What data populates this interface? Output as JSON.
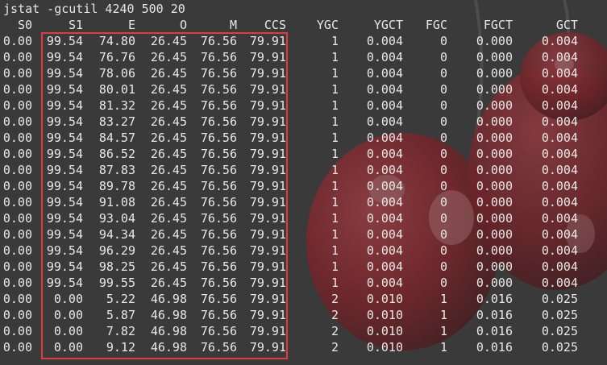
{
  "command": "jstat -gcutil 4240 500 20",
  "colors": {
    "terminal_background": "#3c3c3c",
    "text": "#e6e6e6",
    "highlight_border": "#e23b3b",
    "cherry_red": "#b3161f"
  },
  "table": {
    "headers": [
      "S0",
      "S1",
      "E",
      "O",
      "M",
      "CCS",
      "YGC",
      "YGCT",
      "FGC",
      "FGCT",
      "GCT"
    ],
    "rows": [
      [
        "0.00",
        "99.54",
        "74.80",
        "26.45",
        "76.56",
        "79.91",
        "1",
        "0.004",
        "0",
        "0.000",
        "0.004"
      ],
      [
        "0.00",
        "99.54",
        "76.76",
        "26.45",
        "76.56",
        "79.91",
        "1",
        "0.004",
        "0",
        "0.000",
        "0.004"
      ],
      [
        "0.00",
        "99.54",
        "78.06",
        "26.45",
        "76.56",
        "79.91",
        "1",
        "0.004",
        "0",
        "0.000",
        "0.004"
      ],
      [
        "0.00",
        "99.54",
        "80.01",
        "26.45",
        "76.56",
        "79.91",
        "1",
        "0.004",
        "0",
        "0.000",
        "0.004"
      ],
      [
        "0.00",
        "99.54",
        "81.32",
        "26.45",
        "76.56",
        "79.91",
        "1",
        "0.004",
        "0",
        "0.000",
        "0.004"
      ],
      [
        "0.00",
        "99.54",
        "83.27",
        "26.45",
        "76.56",
        "79.91",
        "1",
        "0.004",
        "0",
        "0.000",
        "0.004"
      ],
      [
        "0.00",
        "99.54",
        "84.57",
        "26.45",
        "76.56",
        "79.91",
        "1",
        "0.004",
        "0",
        "0.000",
        "0.004"
      ],
      [
        "0.00",
        "99.54",
        "86.52",
        "26.45",
        "76.56",
        "79.91",
        "1",
        "0.004",
        "0",
        "0.000",
        "0.004"
      ],
      [
        "0.00",
        "99.54",
        "87.83",
        "26.45",
        "76.56",
        "79.91",
        "1",
        "0.004",
        "0",
        "0.000",
        "0.004"
      ],
      [
        "0.00",
        "99.54",
        "89.78",
        "26.45",
        "76.56",
        "79.91",
        "1",
        "0.004",
        "0",
        "0.000",
        "0.004"
      ],
      [
        "0.00",
        "99.54",
        "91.08",
        "26.45",
        "76.56",
        "79.91",
        "1",
        "0.004",
        "0",
        "0.000",
        "0.004"
      ],
      [
        "0.00",
        "99.54",
        "93.04",
        "26.45",
        "76.56",
        "79.91",
        "1",
        "0.004",
        "0",
        "0.000",
        "0.004"
      ],
      [
        "0.00",
        "99.54",
        "94.34",
        "26.45",
        "76.56",
        "79.91",
        "1",
        "0.004",
        "0",
        "0.000",
        "0.004"
      ],
      [
        "0.00",
        "99.54",
        "96.29",
        "26.45",
        "76.56",
        "79.91",
        "1",
        "0.004",
        "0",
        "0.000",
        "0.004"
      ],
      [
        "0.00",
        "99.54",
        "98.25",
        "26.45",
        "76.56",
        "79.91",
        "1",
        "0.004",
        "0",
        "0.000",
        "0.004"
      ],
      [
        "0.00",
        "99.54",
        "99.55",
        "26.45",
        "76.56",
        "79.91",
        "1",
        "0.004",
        "0",
        "0.000",
        "0.004"
      ],
      [
        "0.00",
        "0.00",
        "5.22",
        "46.98",
        "76.56",
        "79.91",
        "2",
        "0.010",
        "1",
        "0.016",
        "0.025"
      ],
      [
        "0.00",
        "0.00",
        "5.87",
        "46.98",
        "76.56",
        "79.91",
        "2",
        "0.010",
        "1",
        "0.016",
        "0.025"
      ],
      [
        "0.00",
        "0.00",
        "7.82",
        "46.98",
        "76.56",
        "79.91",
        "2",
        "0.010",
        "1",
        "0.016",
        "0.025"
      ],
      [
        "0.00",
        "0.00",
        "9.12",
        "46.98",
        "76.56",
        "79.91",
        "2",
        "0.010",
        "1",
        "0.016",
        "0.025"
      ]
    ]
  }
}
